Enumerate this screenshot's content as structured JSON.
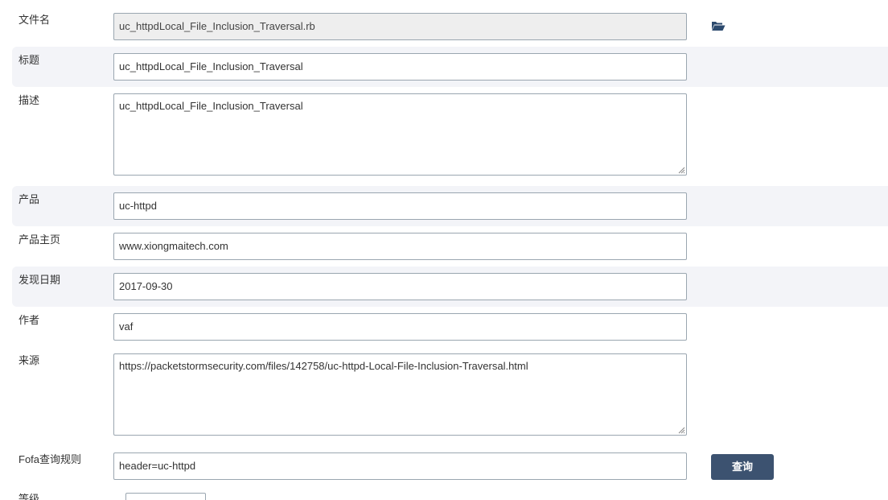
{
  "form": {
    "filename": {
      "label": "文件名",
      "value": "uc_httpdLocal_File_Inclusion_Traversal.rb"
    },
    "title": {
      "label": "标题",
      "value": "uc_httpdLocal_File_Inclusion_Traversal"
    },
    "description": {
      "label": "描述",
      "value": "uc_httpdLocal_File_Inclusion_Traversal"
    },
    "product": {
      "label": "产品",
      "value": "uc-httpd"
    },
    "homepage": {
      "label": "产品主页",
      "value": "www.xiongmaitech.com"
    },
    "disclosure_date": {
      "label": "发现日期",
      "value": "2017-09-30"
    },
    "author": {
      "label": "作者",
      "value": "vaf"
    },
    "source": {
      "label": "来源",
      "value": "https://packetstormsecurity.com/files/142758/uc-httpd-Local-File-Inclusion-Traversal.html"
    },
    "fofa_query": {
      "label": "Fofa查询规则",
      "value": "header=uc-httpd",
      "button_label": "查询"
    },
    "level": {
      "label": "等级"
    }
  },
  "icons": {
    "open_file": "folder-open-icon"
  },
  "colors": {
    "accent": "#3c5270",
    "stripe": "#f3f4f8",
    "readonly_bg": "#eeeeee",
    "icon": "#2c4a6e"
  }
}
